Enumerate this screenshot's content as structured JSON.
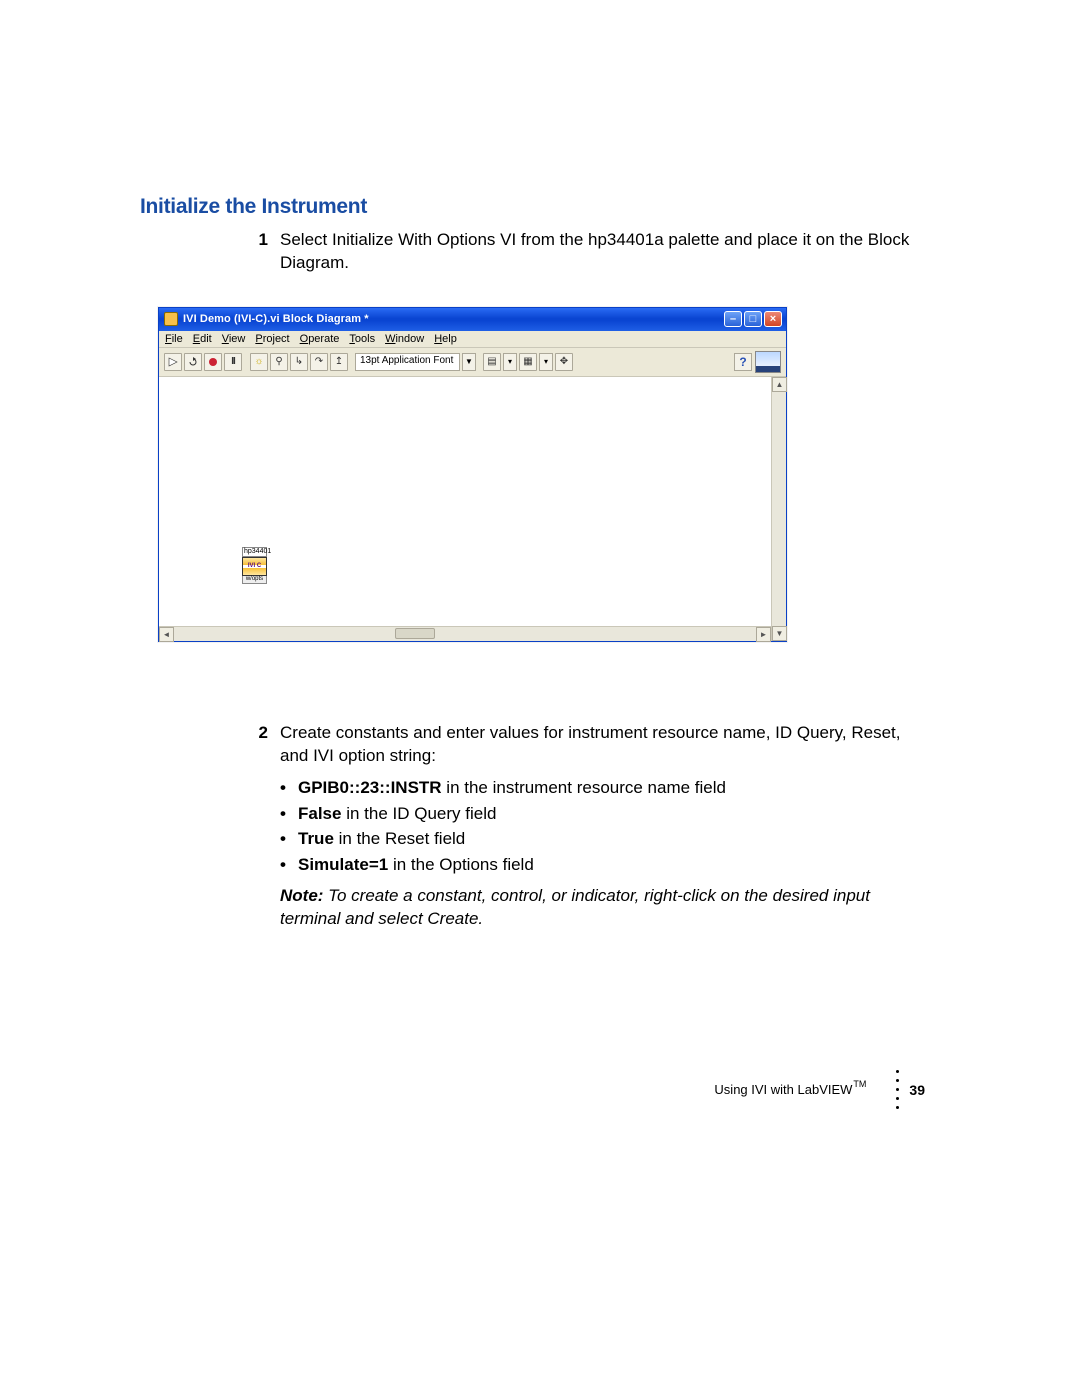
{
  "heading": "Initialize the Instrument",
  "step1": {
    "num": "1",
    "text": "Select Initialize With Options VI from the hp34401a palette and place it on the Block Diagram."
  },
  "screenshot": {
    "title": "IVI Demo (IVI-C).vi Block Diagram *",
    "menus": [
      "File",
      "Edit",
      "View",
      "Project",
      "Operate",
      "Tools",
      "Window",
      "Help"
    ],
    "font_label": "13pt Application Font",
    "node_label_top": "hp34401",
    "node_body": "IVI C",
    "node_label_bottom": "w/opts"
  },
  "step2": {
    "num": "2",
    "intro": "Create constants and enter values for instrument resource name, ID Query, Reset, and IVI option string:",
    "bullets": [
      {
        "bold": "GPIB0::23::INSTR",
        "rest": " in the instrument resource name field"
      },
      {
        "bold": "False",
        "rest": " in the ID Query field"
      },
      {
        "bold": "True",
        "rest": " in the Reset field"
      },
      {
        "bold": "Simulate=1",
        "rest": " in the Options field"
      }
    ],
    "note_label": "Note:",
    "note_text": " To create a constant, control, or indicator, right-click on the desired input terminal and select Create."
  },
  "footer": {
    "text": "Using IVI with LabVIEW",
    "tm": "TM",
    "page": "39"
  }
}
